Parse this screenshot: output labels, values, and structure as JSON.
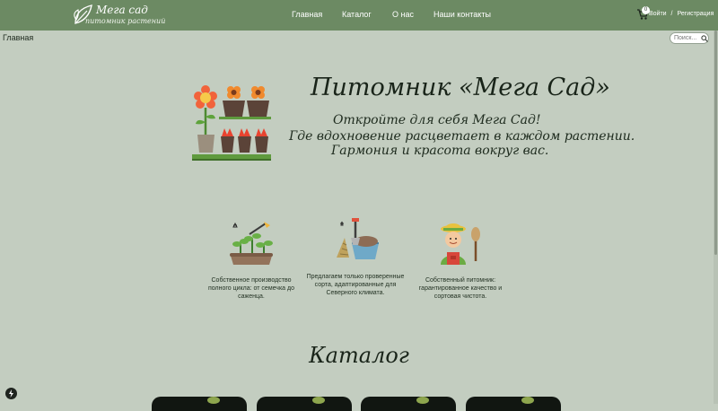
{
  "header": {
    "brand_title": "Мега сад",
    "brand_subtitle": "питомник растений",
    "nav": [
      "Главная",
      "Каталог",
      "О нас",
      "Наши контакты"
    ],
    "cart_count": "0",
    "login": "Войти",
    "separator": "/",
    "register": "Регистрация"
  },
  "breadcrumb": "Главная",
  "search": {
    "placeholder": "Поиск..."
  },
  "hero": {
    "title": "Питомник «Мега Сад»",
    "line1": "Откройте для себя Мега Сад!",
    "line2": "Где вдохновение расцветает в каждом растении.",
    "line3": "Гармония и красота вокруг вас."
  },
  "features": [
    {
      "text": "Собственное производство полного цикла: от семечка до саженца."
    },
    {
      "text": "Предлагаем только проверенные сорта, адаптированные для Северного климата."
    },
    {
      "text": "Собственный питомник: гарантированное качество и сортовая чистота."
    }
  ],
  "catalog": {
    "title": "Каталог"
  },
  "colors": {
    "header": "#6c8a63",
    "background": "#c3cdc0",
    "accent": "#e7473b"
  }
}
